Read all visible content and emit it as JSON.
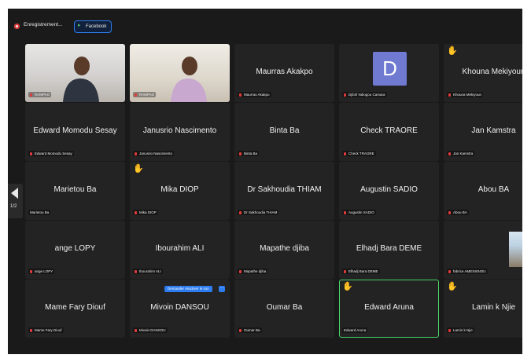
{
  "toolbar": {
    "recording_label": "Enregistrement...",
    "facebook_label": "Facebook"
  },
  "navigation": {
    "page_indicator": "1/2"
  },
  "tiles": [
    {
      "name": "",
      "footer": "RAMPAO",
      "video": true
    },
    {
      "name": "",
      "footer": "RAMPAO",
      "video": true
    },
    {
      "name": "Maurras Akakpo",
      "footer": "Maurras Akakpo"
    },
    {
      "name": "",
      "footer": "Djibril Ndiogou Camara",
      "avatar_letter": "D"
    },
    {
      "name": "Khouna Mekiyoun",
      "footer": "Khouna Mekiyoun",
      "hand": true
    },
    {
      "name": "Edward Momodu Sesay",
      "footer": "Edward Momodu Sesay"
    },
    {
      "name": "Janusrio Nascimento",
      "footer": "Janusrio Nascimento"
    },
    {
      "name": "Binta Ba",
      "footer": "Binta Ba"
    },
    {
      "name": "Check TRAORE",
      "footer": "Check TRAORE"
    },
    {
      "name": "Jan Kamstra",
      "footer": "Jan Kamstra"
    },
    {
      "name": "Marietou Ba",
      "footer": "Marietou Ba",
      "no_mic": true
    },
    {
      "name": "Mika DIOP",
      "footer": "Mika DIOP",
      "hand": true
    },
    {
      "name": "Dr Sakhoudia THIAM",
      "footer": "Dr Sakhoudia THIAM"
    },
    {
      "name": "Augustin SADIO",
      "footer": "Augustin SADIO"
    },
    {
      "name": "Abou BA",
      "footer": "Abou BA"
    },
    {
      "name": "ange LOPY",
      "footer": "ange LOPY"
    },
    {
      "name": "Ibourahim ALI",
      "footer": "Ibourahim ALI"
    },
    {
      "name": "Mapathe djiba",
      "footer": "Mapathe djiba"
    },
    {
      "name": "Elhadj Bara DEME",
      "footer": "Elhadj Bara DEME"
    },
    {
      "name": "",
      "footer": "fabrice AMESSINOU",
      "photo": true
    },
    {
      "name": "Mame Fary Diouf",
      "footer": "Mame Fary Diouf"
    },
    {
      "name": "Mivoin DANSOU",
      "footer": "Mivoin DANSOU",
      "badge": "Demander réactiver le son",
      "more": "···"
    },
    {
      "name": "Oumar Ba",
      "footer": "Oumar Ba"
    },
    {
      "name": "Edward Aruna",
      "footer": "Edward Aruna",
      "hand": true,
      "active": true,
      "no_mic": true
    },
    {
      "name": "Lamin k Njie",
      "footer": "Lamin k Njie",
      "hand": true
    }
  ]
}
